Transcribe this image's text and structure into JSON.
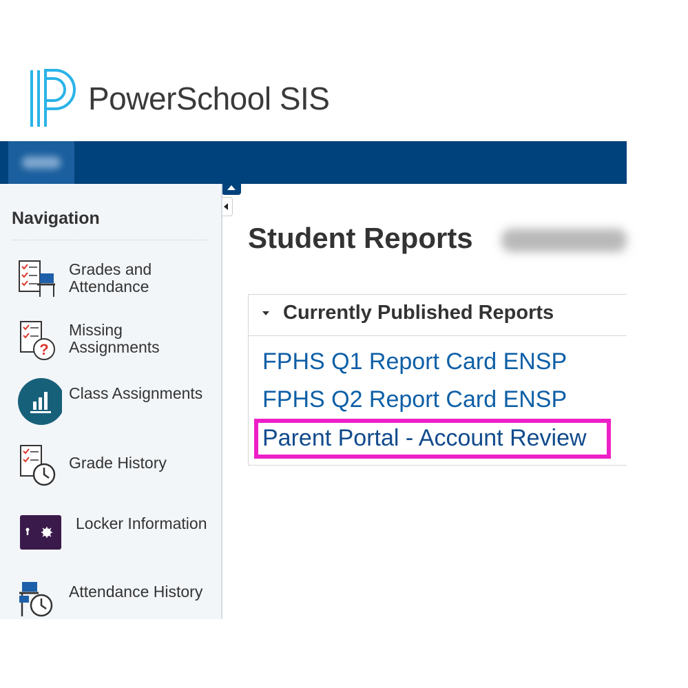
{
  "app": {
    "title": "PowerSchool SIS"
  },
  "topbar": {
    "tab_label": ""
  },
  "sidebar": {
    "heading": "Navigation",
    "items": [
      {
        "label": "Grades and Attendance",
        "icon": "grades-attendance-icon"
      },
      {
        "label": "Missing Assignments",
        "icon": "missing-assignments-icon"
      },
      {
        "label": "Class Assignments",
        "icon": "class-assignments-icon"
      },
      {
        "label": "Grade History",
        "icon": "grade-history-icon"
      },
      {
        "label": "Locker Information",
        "icon": "locker-icon"
      },
      {
        "label": "Attendance History",
        "icon": "attendance-history-icon"
      }
    ]
  },
  "main": {
    "title": "Student Reports",
    "panel": {
      "title": "Currently Published Reports",
      "reports": [
        "FPHS Q1 Report Card ENSP",
        "FPHS Q2 Report Card ENSP",
        "Parent Portal - Account Review"
      ]
    }
  },
  "colors": {
    "brand_blue": "#00427c",
    "link_blue": "#0e5fa6",
    "highlight": "#ee1fc6",
    "logo_cyan": "#2ab3e8"
  }
}
